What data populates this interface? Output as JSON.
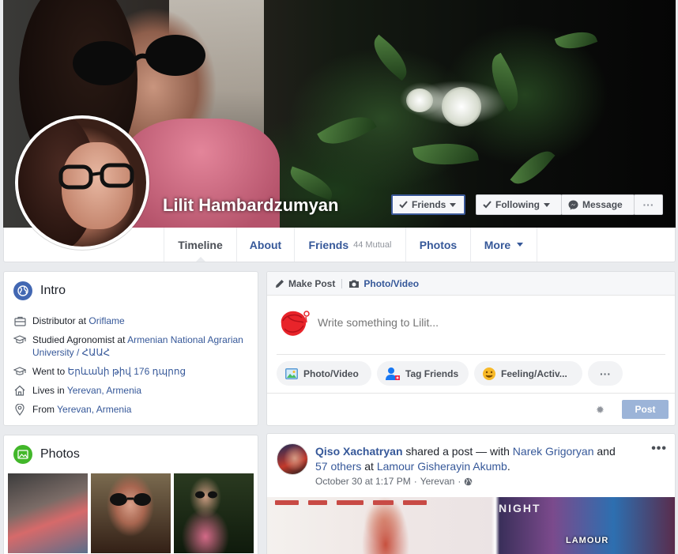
{
  "profile": {
    "name": "Lilit Hambardzumyan",
    "buttons": {
      "friends": "Friends",
      "following": "Following",
      "message": "Message",
      "more": "···"
    }
  },
  "nav": {
    "tabs": {
      "timeline": "Timeline",
      "about": "About",
      "friends": "Friends",
      "friends_mutual": "44 Mutual",
      "photos": "Photos",
      "more": "More"
    }
  },
  "intro": {
    "title": "Intro",
    "items": [
      {
        "icon": "briefcase-icon",
        "prefix": "Distributor at ",
        "link": "Oriflame"
      },
      {
        "icon": "graduation-cap-icon",
        "prefix": "Studied Agronomist at ",
        "link": "Armenian National Agrarian University / ՀԱԱՀ"
      },
      {
        "icon": "graduation-cap-icon",
        "prefix": "Went to ",
        "link": "Երևանի թիվ 176 դպրոց"
      },
      {
        "icon": "home-icon",
        "prefix": "Lives in ",
        "link": "Yerevan, Armenia"
      },
      {
        "icon": "location-pin-icon",
        "prefix": "From ",
        "link": "Yerevan, Armenia"
      }
    ]
  },
  "photos_card": {
    "title": "Photos"
  },
  "composer": {
    "make_post": "Make Post",
    "photo_video_tab": "Photo/Video",
    "placeholder": "Write something to Lilit...",
    "actions": {
      "photo_video": "Photo/Video",
      "tag_friends": "Tag Friends",
      "feeling": "Feeling/Activ...",
      "more": "···"
    },
    "post_button": "Post"
  },
  "post": {
    "author": "Qiso Xachatryan",
    "shared": " shared a post — with ",
    "tagged": "Narek Grigoryan",
    "and": " and ",
    "others": "57 others",
    "at": " at ",
    "place": "Lamour Gisherayin Akumb",
    "period": ".",
    "date": "October 30 at 1:17 PM",
    "location": "Yerevan",
    "sep": "·",
    "image_text_night": "NIGHT",
    "image_text_lamour": "LAMOUR"
  },
  "colors": {
    "brand": "#3b5998",
    "link": "#365899",
    "background": "#e9ebee",
    "post_button_disabled": "#9cb4d8"
  }
}
